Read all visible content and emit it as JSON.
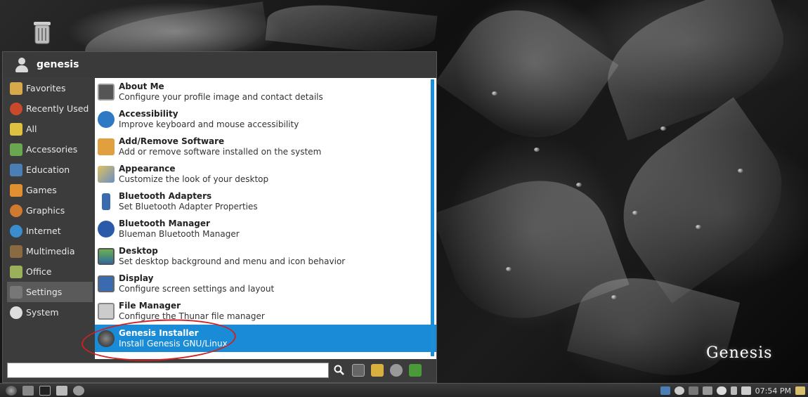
{
  "menu": {
    "username": "genesis",
    "categories": [
      {
        "label": "Favorites",
        "icon": "folder-star-icon"
      },
      {
        "label": "Recently Used",
        "icon": "clock-icon"
      },
      {
        "label": "All",
        "icon": "all-apps-icon"
      },
      {
        "label": "Accessories",
        "icon": "accessories-icon"
      },
      {
        "label": "Education",
        "icon": "education-icon"
      },
      {
        "label": "Games",
        "icon": "games-icon"
      },
      {
        "label": "Graphics",
        "icon": "graphics-icon"
      },
      {
        "label": "Internet",
        "icon": "globe-icon"
      },
      {
        "label": "Multimedia",
        "icon": "multimedia-icon"
      },
      {
        "label": "Office",
        "icon": "office-icon"
      },
      {
        "label": "Settings",
        "icon": "settings-icon",
        "active": true
      },
      {
        "label": "System",
        "icon": "gear-icon"
      }
    ],
    "apps": [
      {
        "title": "About Me",
        "desc": "Configure your profile image and contact details",
        "icon": "user-card-icon"
      },
      {
        "title": "Accessibility",
        "desc": "Improve keyboard and mouse accessibility",
        "icon": "accessibility-icon"
      },
      {
        "title": "Add/Remove Software",
        "desc": "Add or remove software installed on the system",
        "icon": "package-icon"
      },
      {
        "title": "Appearance",
        "desc": "Customize the look of your desktop",
        "icon": "appearance-icon"
      },
      {
        "title": "Bluetooth Adapters",
        "desc": "Set Bluetooth Adapter Properties",
        "icon": "bluetooth-adapter-icon"
      },
      {
        "title": "Bluetooth Manager",
        "desc": "Blueman Bluetooth Manager",
        "icon": "bluetooth-icon"
      },
      {
        "title": "Desktop",
        "desc": "Set desktop background and menu and icon behavior",
        "icon": "desktop-icon"
      },
      {
        "title": "Display",
        "desc": "Configure screen settings and layout",
        "icon": "display-icon"
      },
      {
        "title": "File Manager",
        "desc": "Configure the Thunar file manager",
        "icon": "file-manager-icon"
      },
      {
        "title": "Genesis Installer",
        "desc": "Install Genesis GNU/Linux",
        "icon": "installer-icon",
        "selected": true
      }
    ],
    "search_value": "",
    "tools": [
      "search-icon",
      "settings-manager-icon",
      "lock-screen-icon",
      "switch-user-icon",
      "logout-icon"
    ]
  },
  "desktop": {
    "logo_text": "Genesis"
  },
  "taskbar": {
    "clock": "07:54 PM"
  },
  "colors": {
    "selection": "#1a8bd6",
    "annotation": "#d02020"
  }
}
